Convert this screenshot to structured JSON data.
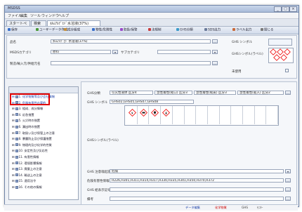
{
  "window": {
    "app_name": "MSDSS",
    "controls": [
      "_",
      "□",
      "×"
    ]
  },
  "menu": [
    "ファイル",
    "編集",
    "ツール",
    "ウィンドウ",
    "ヘルプ"
  ],
  "tabs": [
    {
      "label": "スタートページ"
    },
    {
      "label": "検索"
    },
    {
      "label": "ﾎﾙﾑｱﾙﾃﾞﾋﾄﾞ水溶液(37%)"
    }
  ],
  "toolbar": [
    {
      "label": "保存",
      "color": "#3a6fc9"
    },
    {
      "label": "ユーザーデータ作成",
      "color": "#4a9a3a"
    },
    {
      "label": "成分組成",
      "color": "#c9913a"
    },
    {
      "label": "物性/危険性",
      "color": "#3a6fc9"
    },
    {
      "label": "取扱/保管",
      "color": "#9a4ac9"
    },
    {
      "label": "法規制",
      "color": "#c93a3a"
    },
    {
      "label": "GHS分類",
      "color": "#3a9ac9"
    },
    {
      "label": "SDS出力",
      "color": "#6a7a9a"
    },
    {
      "label": "ラベル出力",
      "color": "#c96a3a"
    },
    {
      "label": "閉じる",
      "color": "#7a7a7a"
    }
  ],
  "header": {
    "name_label": "品名",
    "name_value": "ﾎﾙﾑｱﾙﾃﾞﾋﾄﾞ水溶液(37%)",
    "category_label": "MSDSカテゴリ",
    "category_value": "原料",
    "subcategory_label": "サブカテゴリ",
    "subcategory_value": "",
    "supplier_label": "製造/輸入元/供給元名",
    "supplier_value": "",
    "ghs_symbol_label": "GHS シンボル",
    "ghs_symbol_label2": "GHSシンボル(ラベル)",
    "doc_label": "PDF",
    "checkbox_label": "未使用"
  },
  "tree": {
    "header": "",
    "nodes": [
      {
        "label": "1. 化学物質等及び会社情報",
        "indent": 0
      },
      {
        "label": "2. 危険有害性の要約",
        "indent": 0
      },
      {
        "label": "3. 組成、成分情報",
        "indent": 0
      },
      {
        "label": "4. 応急措置",
        "indent": 0
      },
      {
        "label": "5. 火災時の措置",
        "indent": 0
      },
      {
        "label": "6. 漏出時の措置",
        "indent": 0
      },
      {
        "label": "7. 取扱い及び保管上の注意",
        "indent": 0
      },
      {
        "label": "8. 暴露防止及び保護措置",
        "indent": 0
      },
      {
        "label": "9. 物理的及び化学的性質",
        "indent": 0
      },
      {
        "label": "10. 安定性及び反応性",
        "indent": 0
      },
      {
        "label": "11. 有害性情報",
        "indent": 0
      },
      {
        "label": "12. 環境影響情報",
        "indent": 0
      },
      {
        "label": "13. 廃棄上の注意",
        "indent": 0
      },
      {
        "label": "14. 輸送上の注意",
        "indent": 0
      },
      {
        "label": "15. 適用法令",
        "indent": 0
      },
      {
        "label": "16. その他の情報",
        "indent": 0
      }
    ]
  },
  "detail": {
    "hazard_class_label": "GHS分類",
    "hazard_class_options": [
      "引火性液体 区分4",
      "急性毒性(経口) 区分3",
      "急性毒性(経皮) 区分3",
      "急性毒性(吸入) 区分2"
    ],
    "ghs_symbol_label": "GHS シンボル",
    "ghs_symbol_value": "GHS02,GHS05,GHS07,GHS08",
    "ghs_symbols": [
      "flame",
      "corrosion",
      "skull",
      "health"
    ],
    "ghs_label_label": "GHSシンボル(ラベル)",
    "signal_word_label": "GHS 注意喚起語",
    "signal_word_value": "危険",
    "hazard_stmt_label": "危険有害性情報",
    "hazard_stmt_value": "H226,H301,H311,H314,H317,H330,H335,H341,H350,H370,H372",
    "prec_stmt_label": "GHS 絵表示記号",
    "prec_stmt_value": "",
    "remarks_label": "備考",
    "remarks_value": ""
  },
  "status": {
    "left": "",
    "items": [
      "データ編集",
      "化学物質",
      "GHS",
      "ﾓﾆﾀｰ"
    ]
  },
  "colors": {
    "highlight": "#e00000",
    "window_border": "#6f84a8",
    "titlebar": "#a9bcd9"
  }
}
